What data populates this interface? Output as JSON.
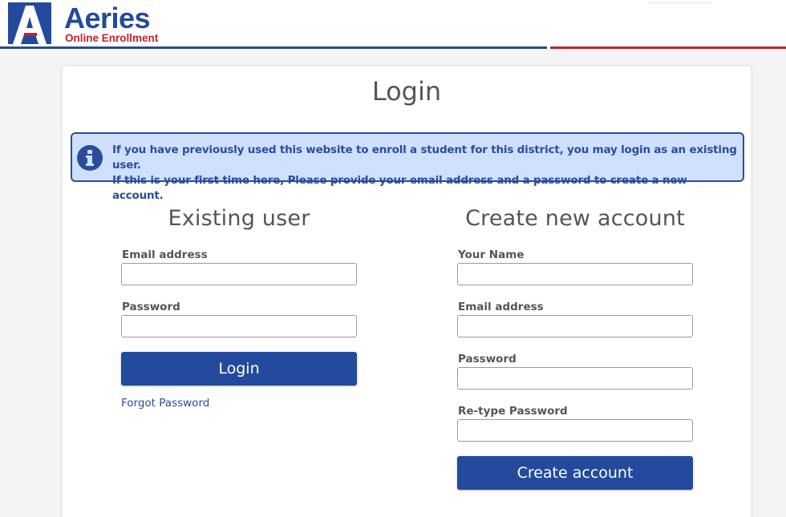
{
  "header": {
    "logo_letter": "A",
    "logo_word": "Aeries",
    "logo_subtitle": "Online Enrollment",
    "brand_blue": "#234a9c",
    "brand_red": "#c4232b"
  },
  "page_title": "Login",
  "info": {
    "icon": "info-icon",
    "line1": "If you have previously used this website to enroll a student for this district, you may login as an existing user.",
    "line2": "If this is your first time here, Please provide your email address and a password to create a new account."
  },
  "existing_user": {
    "heading": "Existing user",
    "email_label": "Email address",
    "email_value": "",
    "password_label": "Password",
    "password_value": "",
    "login_button": "Login",
    "forgot_link": "Forgot Password"
  },
  "new_account": {
    "heading": "Create new account",
    "name_label": "Your Name",
    "name_value": "",
    "email_label": "Email address",
    "email_value": "",
    "password_label": "Password",
    "password_value": "",
    "retype_label": "Re-type Password",
    "retype_value": "",
    "create_button": "Create account"
  }
}
